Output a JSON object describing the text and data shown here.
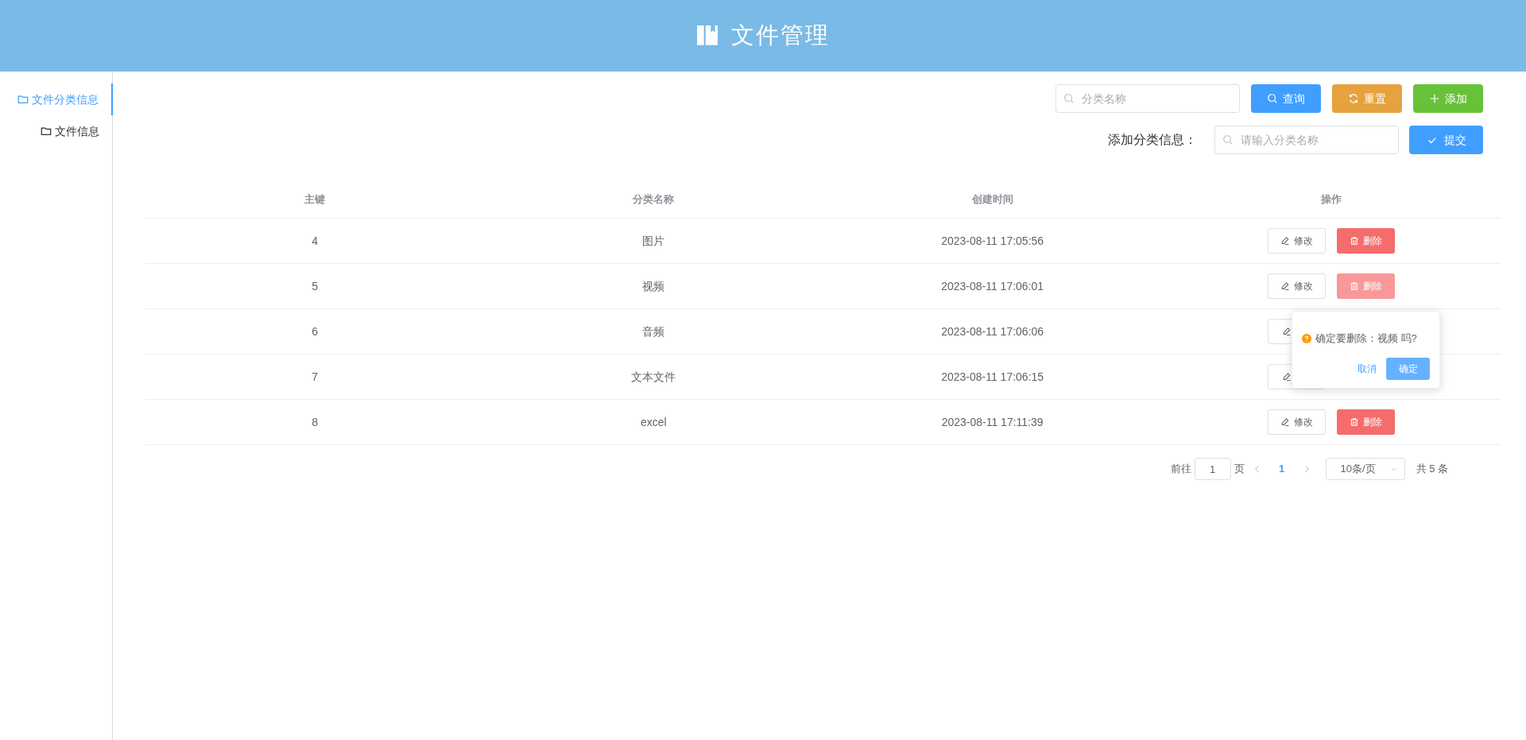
{
  "header": {
    "title": "文件管理"
  },
  "sidebar": {
    "items": [
      {
        "label": "文件分类信息",
        "selected": true
      },
      {
        "label": "文件信息",
        "selected": false
      }
    ]
  },
  "toolbar": {
    "search": {
      "placeholder": "分类名称"
    },
    "buttons": [
      {
        "kind": "search",
        "label": "查询"
      },
      {
        "kind": "reset",
        "label": "重置"
      },
      {
        "kind": "add",
        "label": "添加"
      }
    ]
  },
  "add_form": {
    "label": "添加分类信息：",
    "input": {
      "placeholder": "请输入分类名称"
    },
    "submit": "提交"
  },
  "table": {
    "columns": [
      "主键",
      "分类名称",
      "创建时间",
      "操作"
    ],
    "rows": [
      {
        "cells": [
          "4",
          "图片",
          "2023-08-11 17:05:56"
        ],
        "actions": [
          {
            "kind": "edit",
            "label": "修改"
          },
          {
            "kind": "delete",
            "label": "删除",
            "active": false
          }
        ]
      },
      {
        "cells": [
          "5",
          "视频",
          "2023-08-11 17:06:01"
        ],
        "actions": [
          {
            "kind": "edit",
            "label": "修改"
          },
          {
            "kind": "delete",
            "label": "删除",
            "active": true
          }
        ]
      },
      {
        "cells": [
          "6",
          "音频",
          "2023-08-11 17:06:06"
        ],
        "actions": [
          {
            "kind": "edit"
          }
        ]
      },
      {
        "cells": [
          "7",
          "文本文件",
          "2023-08-11 17:06:15"
        ],
        "actions": [
          {
            "kind": "edit"
          }
        ]
      },
      {
        "cells": [
          "8",
          "excel",
          "2023-08-11 17:11:39"
        ],
        "actions": [
          {
            "kind": "edit",
            "label": "修改"
          },
          {
            "kind": "delete",
            "label": "删除",
            "active": false
          }
        ]
      }
    ]
  },
  "popconfirm": {
    "message": "确定要删除：视频 吗?",
    "cancel": "取消",
    "confirm": "确定"
  },
  "pagination": {
    "goto_prefix": "前往",
    "page_input": "1",
    "goto_suffix": "页",
    "pages": [
      {
        "label": "1",
        "selected": true
      }
    ],
    "page_size": "10条/页",
    "total": "共 5 条"
  }
}
